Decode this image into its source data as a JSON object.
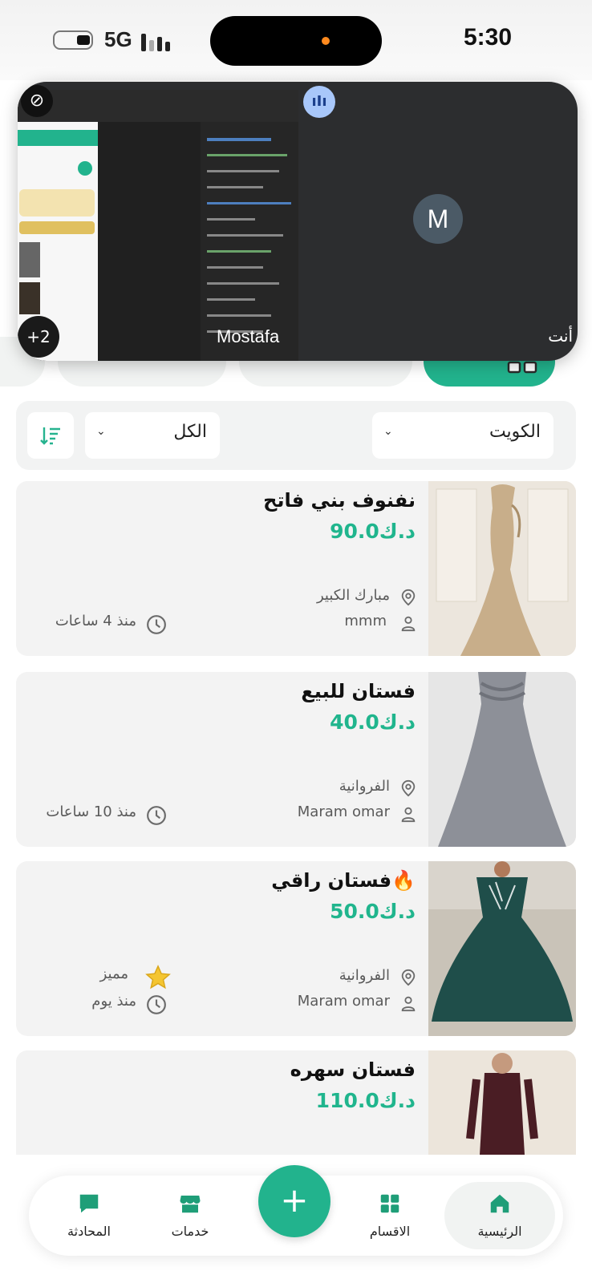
{
  "status_bar": {
    "time": "5:30",
    "network": "5G"
  },
  "call": {
    "participant_initial": "M",
    "participant_name": "Mostafa",
    "self_label": "أنت",
    "extra_participants": "+2"
  },
  "filters": {
    "region": "الكويت",
    "category": "الكل"
  },
  "listings": [
    {
      "title": "نفنوف بني فاتح",
      "price": "90.0د.ك",
      "location": "مبارك الكبير",
      "user": "mmm",
      "time": "منذ 4 ساعات",
      "featured": ""
    },
    {
      "title": "فستان للبيع",
      "price": "40.0د.ك",
      "location": "الفروانية",
      "user": "Maram omar",
      "time": "منذ 10 ساعات",
      "featured": ""
    },
    {
      "title": "فستان راقي🔥",
      "price": "50.0د.ك",
      "location": "الفروانية",
      "user": "Maram omar",
      "time": "منذ يوم",
      "featured": "مميز"
    },
    {
      "title": "فستان سهره",
      "price": "110.0د.ك",
      "location": "",
      "user": "",
      "time": "",
      "featured": ""
    }
  ],
  "nav": {
    "home": "الرئيسية",
    "sections": "الاقسام",
    "add": "+",
    "services": "خدمات",
    "chat": "المحادثة"
  },
  "colors": {
    "accent": "#22b38d",
    "price": "#20b58d"
  }
}
